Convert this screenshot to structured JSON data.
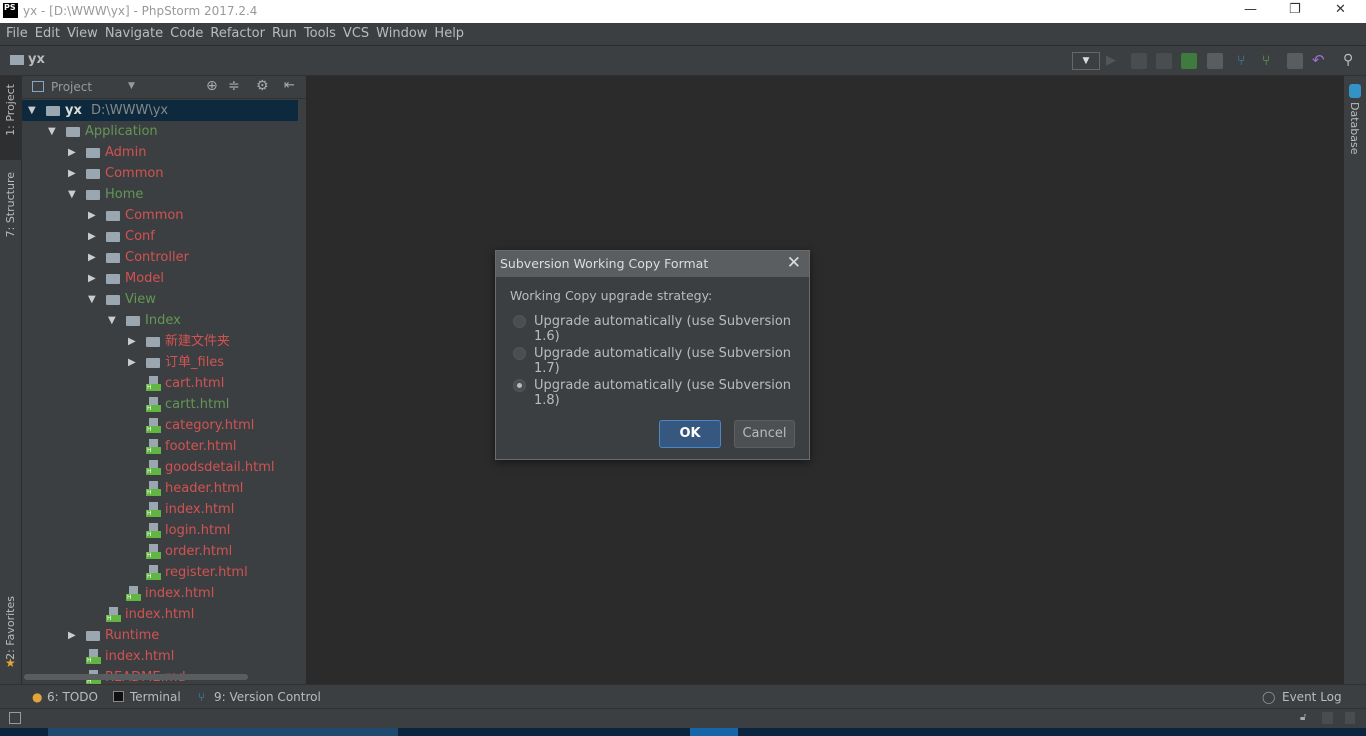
{
  "window": {
    "logo": "PS",
    "title": "yx - [D:\\WWW\\yx] - PhpStorm 2017.2.4",
    "minimize": "—",
    "maximize": "❐",
    "close": "✕"
  },
  "menu": [
    "File",
    "Edit",
    "View",
    "Navigate",
    "Code",
    "Refactor",
    "Run",
    "Tools",
    "VCS",
    "Window",
    "Help"
  ],
  "breadcrumb": "yx",
  "left_tabs": {
    "project": "1: Project",
    "structure": "7: Structure",
    "favorites": "2: Favorites"
  },
  "right_tabs": {
    "database": "Database"
  },
  "panel": {
    "title": "Project"
  },
  "tree": [
    {
      "label": "yx",
      "extra": "D:\\WWW\\yx",
      "level": 0,
      "type": "folder",
      "expanded": true,
      "color": "bold",
      "selected": true
    },
    {
      "label": "Application",
      "level": 1,
      "type": "folder",
      "expanded": true,
      "color": "green"
    },
    {
      "label": "Admin",
      "level": 2,
      "type": "folder",
      "expanded": false,
      "color": "red"
    },
    {
      "label": "Common",
      "level": 2,
      "type": "folder",
      "expanded": false,
      "color": "red"
    },
    {
      "label": "Home",
      "level": 2,
      "type": "folder",
      "expanded": true,
      "color": "green"
    },
    {
      "label": "Common",
      "level": 3,
      "type": "folder",
      "expanded": false,
      "color": "red"
    },
    {
      "label": "Conf",
      "level": 3,
      "type": "folder",
      "expanded": false,
      "color": "red"
    },
    {
      "label": "Controller",
      "level": 3,
      "type": "folder",
      "expanded": false,
      "color": "red"
    },
    {
      "label": "Model",
      "level": 3,
      "type": "folder",
      "expanded": false,
      "color": "red"
    },
    {
      "label": "View",
      "level": 3,
      "type": "folder",
      "expanded": true,
      "color": "green"
    },
    {
      "label": "Index",
      "level": 4,
      "type": "folder",
      "expanded": true,
      "color": "green"
    },
    {
      "label": "新建文件夹",
      "level": 5,
      "type": "folder",
      "expanded": false,
      "color": "red"
    },
    {
      "label": "订单_files",
      "level": 5,
      "type": "folder",
      "expanded": false,
      "color": "red"
    },
    {
      "label": "cart.html",
      "level": 5,
      "type": "file",
      "color": "red"
    },
    {
      "label": "cartt.html",
      "level": 5,
      "type": "file",
      "color": "green"
    },
    {
      "label": "category.html",
      "level": 5,
      "type": "file",
      "color": "red"
    },
    {
      "label": "footer.html",
      "level": 5,
      "type": "file",
      "color": "red"
    },
    {
      "label": "goodsdetail.html",
      "level": 5,
      "type": "file",
      "color": "red"
    },
    {
      "label": "header.html",
      "level": 5,
      "type": "file",
      "color": "red"
    },
    {
      "label": "index.html",
      "level": 5,
      "type": "file",
      "color": "red"
    },
    {
      "label": "login.html",
      "level": 5,
      "type": "file",
      "color": "red"
    },
    {
      "label": "order.html",
      "level": 5,
      "type": "file",
      "color": "red"
    },
    {
      "label": "register.html",
      "level": 5,
      "type": "file",
      "color": "red"
    },
    {
      "label": "index.html",
      "level": 4,
      "type": "file",
      "color": "red"
    },
    {
      "label": "index.html",
      "level": 3,
      "type": "file",
      "color": "red"
    },
    {
      "label": "Runtime",
      "level": 2,
      "type": "folder",
      "expanded": false,
      "color": "red"
    },
    {
      "label": "index.html",
      "level": 2,
      "type": "file",
      "color": "red"
    },
    {
      "label": "README.md",
      "level": 2,
      "type": "file",
      "color": "red"
    }
  ],
  "bottom_tabs": {
    "todo": "6: TODO",
    "terminal": "Terminal",
    "vcs": "9: Version Control",
    "event_log": "Event Log"
  },
  "dialog": {
    "title": "Subversion Working Copy Format",
    "prompt": "Working Copy upgrade strategy:",
    "options": [
      {
        "label": "Upgrade automatically (use Subversion 1.6)",
        "selected": false
      },
      {
        "label": "Upgrade automatically (use Subversion 1.7)",
        "selected": false
      },
      {
        "label": "Upgrade automatically (use Subversion 1.8)",
        "selected": true
      }
    ],
    "ok": "OK",
    "cancel": "Cancel",
    "close": "✕"
  },
  "colors": {
    "modified": "#d25252",
    "added": "#629755",
    "selection": "#0d293e"
  }
}
